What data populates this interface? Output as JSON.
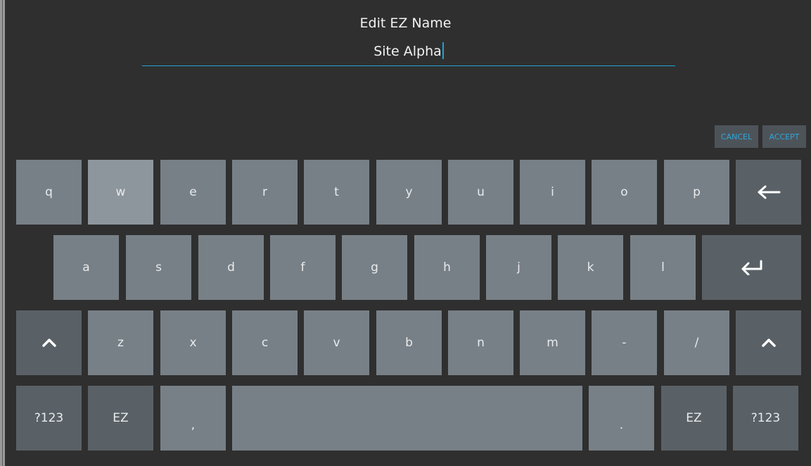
{
  "dialog": {
    "title": "Edit EZ Name",
    "input_value": "Site Alpha"
  },
  "actions": {
    "cancel_label": "CANCEL",
    "accept_label": "ACCEPT"
  },
  "keyboard": {
    "row1": [
      "q",
      "w",
      "e",
      "r",
      "t",
      "y",
      "u",
      "i",
      "o",
      "p"
    ],
    "row2": [
      "a",
      "s",
      "d",
      "f",
      "g",
      "h",
      "j",
      "k",
      "l"
    ],
    "row3": [
      "z",
      "x",
      "c",
      "v",
      "b",
      "n",
      "m",
      "-",
      "/"
    ],
    "row4": {
      "left_symbols": "?123",
      "left_ez": "EZ",
      "comma": ",",
      "period": ".",
      "right_ez": "EZ",
      "right_symbols": "?123"
    },
    "pressed_key": "w",
    "icons": {
      "backspace": "backspace-arrow-icon",
      "enter": "enter-return-icon",
      "shift": "shift-chevron-up-icon"
    }
  },
  "colors": {
    "background": "#2f2f2f",
    "key": "#788087",
    "key_dark": "#5a6166",
    "key_pressed": "#8d969c",
    "accent": "#1fa2d4"
  }
}
